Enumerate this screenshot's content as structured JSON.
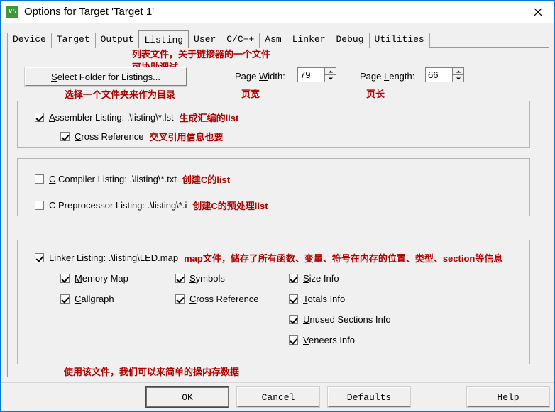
{
  "window": {
    "title": "Options for Target 'Target 1'",
    "icon_label": "V5",
    "close_icon": "close-icon"
  },
  "tabs": [
    {
      "label": "Device",
      "selected": false
    },
    {
      "label": "Target",
      "selected": false
    },
    {
      "label": "Output",
      "selected": false
    },
    {
      "label": "Listing",
      "selected": true
    },
    {
      "label": "User",
      "selected": false
    },
    {
      "label": "C/C++",
      "selected": false
    },
    {
      "label": "Asm",
      "selected": false
    },
    {
      "label": "Linker",
      "selected": false
    },
    {
      "label": "Debug",
      "selected": false
    },
    {
      "label": "Utilities",
      "selected": false
    }
  ],
  "annotations": {
    "top_line1": "列表文件，关于链接器的一个文件",
    "top_line2": "可协助调试",
    "select_folder": "选择一个文件夹来作为目录",
    "page_width": "页宽",
    "page_length": "页长",
    "assembler": "生成汇编的list",
    "cross_reference": "交叉引用信息也要",
    "c_compiler": "创建C的list",
    "c_preprocessor": "创建C的预处理list",
    "linker": "map文件，储存了所有函数、变量、符号在内存的位置、类型、section等信息",
    "linker_use": "使用该文件，我们可以来简单的操内存数据",
    "color": "#b00000"
  },
  "toolbar": {
    "select_folder_label": "Select Folder for Listings..."
  },
  "page_width": {
    "label_pre": "Page ",
    "label_key": "W",
    "label_post": "idth:",
    "value": "79"
  },
  "page_length": {
    "label_pre": "Page ",
    "label_key": "L",
    "label_post": "ength:",
    "value": "66"
  },
  "assembler_group": {
    "listing": {
      "pre": "A",
      "post": "ssembler Listing:  .\\listing\\*.lst",
      "checked": true
    },
    "cross_reference": {
      "pre": "C",
      "post": "ross Reference",
      "checked": true
    }
  },
  "compiler_group": {
    "c_listing": {
      "pre": "C",
      "post": " Compiler Listing:  .\\listing\\*.txt",
      "checked": false
    },
    "c_preprocessor": {
      "pre": "",
      "post": "C Preprocessor Listing:  .\\listing\\*.i",
      "checked": false
    }
  },
  "linker_group": {
    "listing": {
      "pre": "L",
      "post": "inker Listing:  .\\listing\\LED.map",
      "checked": true
    },
    "options": [
      {
        "pre": "M",
        "post": "emory Map",
        "checked": true,
        "col": 0,
        "row": 0
      },
      {
        "pre": "S",
        "post": "ymbols",
        "checked": true,
        "col": 1,
        "row": 0
      },
      {
        "pre": "S",
        "post": "ize Info",
        "checked": true,
        "col": 2,
        "row": 0
      },
      {
        "pre": "C",
        "post": "allgraph",
        "checked": true,
        "col": 0,
        "row": 1
      },
      {
        "pre": "C",
        "post": "ross Reference",
        "checked": true,
        "col": 1,
        "row": 1
      },
      {
        "pre": "T",
        "post": "otals Info",
        "checked": true,
        "col": 2,
        "row": 1
      },
      {
        "pre": "U",
        "post": "nused Sections Info",
        "checked": true,
        "col": 2,
        "row": 2
      },
      {
        "pre": "V",
        "post": "eneers Info",
        "checked": true,
        "col": 2,
        "row": 3
      }
    ]
  },
  "buttons": {
    "ok": "OK",
    "cancel": "Cancel",
    "defaults": "Defaults",
    "help": "Help"
  }
}
